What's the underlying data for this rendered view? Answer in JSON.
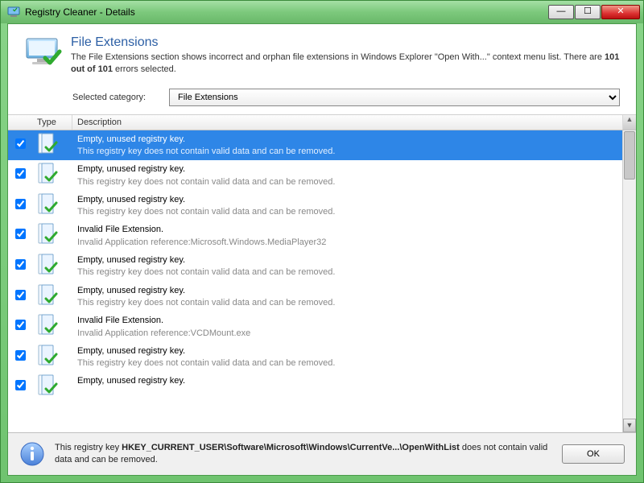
{
  "window": {
    "title": "Registry Cleaner - Details"
  },
  "header": {
    "title": "File Extensions",
    "desc_a": "The File Extensions section shows incorrect and orphan file extensions in Windows Explorer \"Open With...\" context menu list. There are ",
    "desc_b": "101 out of 101",
    "desc_c": " errors selected."
  },
  "category": {
    "label": "Selected category:",
    "value": "File Extensions"
  },
  "cols": {
    "type": "Type",
    "description": "Description"
  },
  "rows": [
    {
      "checked": true,
      "selected": true,
      "title": "Empty, unused registry key.",
      "sub": "This registry key does not contain valid data and can be removed."
    },
    {
      "checked": true,
      "selected": false,
      "title": "Empty, unused registry key.",
      "sub": "This registry key does not contain valid data and can be removed."
    },
    {
      "checked": true,
      "selected": false,
      "title": "Empty, unused registry key.",
      "sub": "This registry key does not contain valid data and can be removed."
    },
    {
      "checked": true,
      "selected": false,
      "title": "Invalid File Extension.",
      "sub": "Invalid Application reference:Microsoft.Windows.MediaPlayer32"
    },
    {
      "checked": true,
      "selected": false,
      "title": "Empty, unused registry key.",
      "sub": "This registry key does not contain valid data and can be removed."
    },
    {
      "checked": true,
      "selected": false,
      "title": "Empty, unused registry key.",
      "sub": "This registry key does not contain valid data and can be removed."
    },
    {
      "checked": true,
      "selected": false,
      "title": "Invalid File Extension.",
      "sub": "Invalid Application reference:VCDMount.exe"
    },
    {
      "checked": true,
      "selected": false,
      "title": "Empty, unused registry key.",
      "sub": "This registry key does not contain valid data and can be removed."
    },
    {
      "checked": true,
      "selected": false,
      "title": "Empty, unused registry key.",
      "sub": ""
    }
  ],
  "footer": {
    "pre": "This registry key ",
    "bold": "HKEY_CURRENT_USER\\Software\\Microsoft\\Windows\\CurrentVe...\\OpenWithList",
    "post": " does not contain valid data and can be removed.",
    "ok": "OK"
  }
}
